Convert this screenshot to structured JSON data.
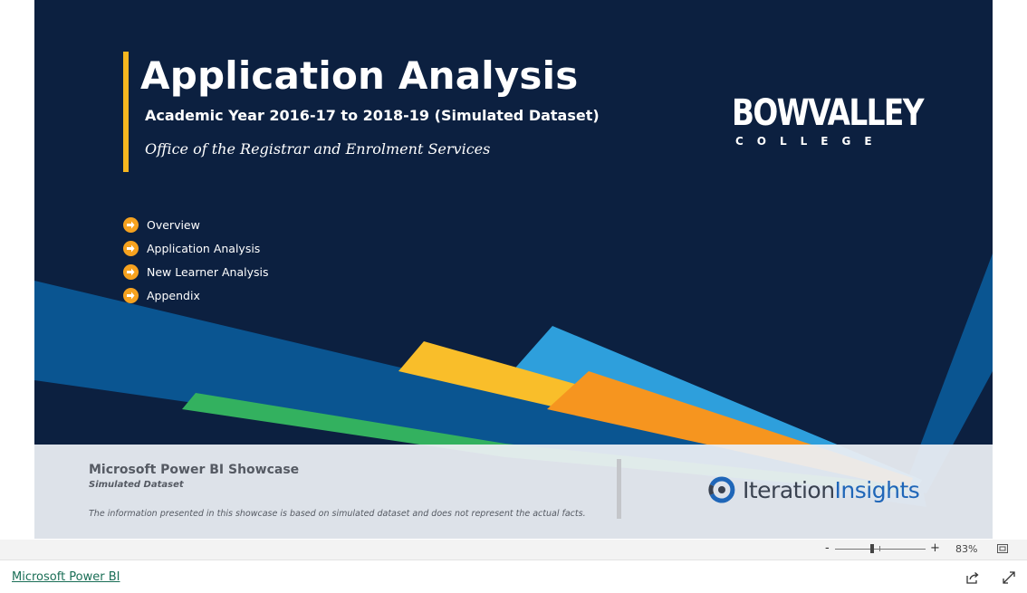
{
  "report": {
    "title": "Application Analysis",
    "subtitle": "Academic Year 2016-17 to 2018-19 (Simulated Dataset)",
    "office": "Office of the Registrar and Enrolment Services",
    "logo_main": "BOWVALLEY",
    "logo_sub": "COLLEGE",
    "nav": [
      {
        "label": "Overview",
        "icon": "arrow-right-circle-icon"
      },
      {
        "label": "Application Analysis",
        "icon": "arrow-right-circle-icon"
      },
      {
        "label": "New Learner Analysis",
        "icon": "arrow-right-circle-icon"
      },
      {
        "label": "Appendix",
        "icon": "arrow-right-circle-icon"
      }
    ],
    "footer": {
      "showcase": "Microsoft Power BI Showcase",
      "simulated": "Simulated Dataset",
      "disclaimer": "The information presented in this showcase is based on simulated dataset and does not represent the actual facts.",
      "brand_a": "Iteration",
      "brand_b": "Insights"
    },
    "colors": {
      "background": "#0c2040",
      "accent": "#f6b61f",
      "bullet": "#f6a21f",
      "brand_blue": "#1f66b8"
    }
  },
  "zoom": {
    "minus": "-",
    "plus": "+",
    "percent": "83%"
  },
  "bottom": {
    "link": "Microsoft Power BI",
    "share_icon": "share-icon",
    "expand_icon": "expand-icon"
  }
}
